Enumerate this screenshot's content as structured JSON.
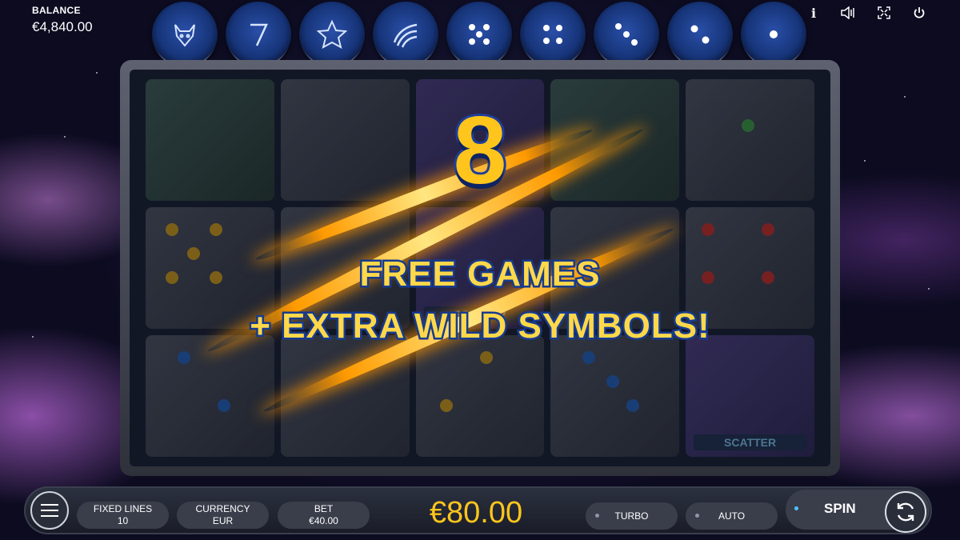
{
  "balance": {
    "label": "BALANCE",
    "value": "€4,840.00"
  },
  "top_icons": [
    "info-icon",
    "sound-icon",
    "fullscreen-icon",
    "power-icon"
  ],
  "paytable_symbols": [
    "wolf-icon",
    "seven-icon",
    "star-icon",
    "claw-icon",
    "dice-five-icon",
    "dice-four-icon",
    "dice-three-icon",
    "dice-two-icon",
    "dice-one-icon"
  ],
  "overlay": {
    "count": "8",
    "line1": "FREE GAMES",
    "line2": "+ EXTRA WILD SYMBOLS!"
  },
  "reels": {
    "scatter_label": "SCATTER"
  },
  "bottom": {
    "fixed_lines_label": "FIXED LINES",
    "fixed_lines_value": "10",
    "currency_label": "CURRENCY",
    "currency_value": "EUR",
    "bet_label": "BET",
    "bet_value": "€40.00",
    "win_amount": "€80.00",
    "turbo_label": "TURBO",
    "auto_label": "AUTO",
    "spin_label": "SPIN"
  },
  "colors": {
    "gold": "#ffc51c",
    "blue_stroke": "#1e3f9a",
    "bar": "#2c3140",
    "spin_led": "#4fc3ff"
  }
}
